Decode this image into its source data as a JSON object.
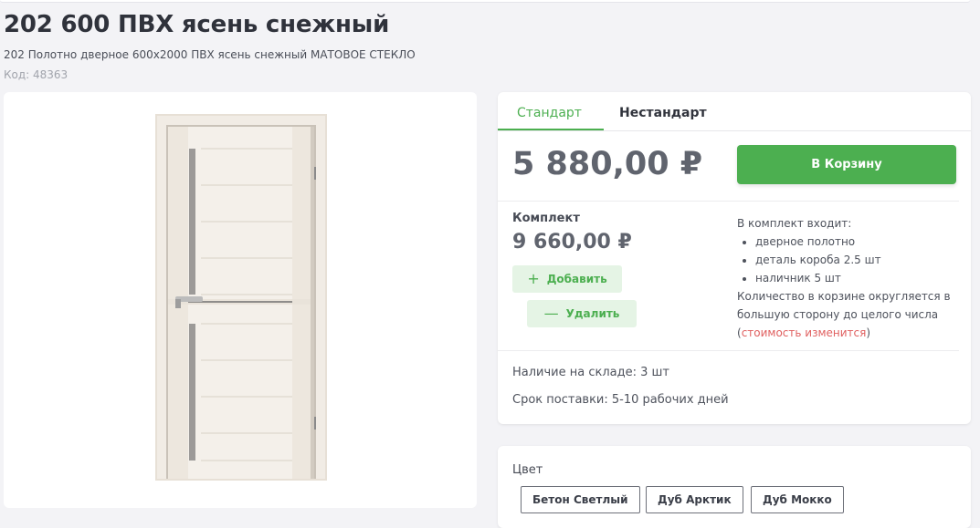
{
  "product": {
    "title": "202 600 ПВХ ясень снежный",
    "subtitle": "202 Полотно дверное 600х2000 ПВХ ясень снежный МАТОВОЕ СТЕКЛО",
    "code": "Код: 48363"
  },
  "tabs": [
    "Стандарт",
    "Нестандарт"
  ],
  "price": "5 880,00 ₽",
  "cart_button": "В Корзину",
  "kit": {
    "label": "Комплект",
    "price": "9 660,00 ₽",
    "add_label": "Добавить",
    "remove_label": "Удалить",
    "includes_title": "В комплект входит:",
    "items": [
      "дверное полотно",
      "деталь короба 2.5 шт",
      "наличник 5 шт"
    ],
    "note": "Количество в корзине округляется в большую сторону до целого числа",
    "note_paren_open": "(",
    "note_warning": "стоимость изменится",
    "note_paren_close": ")"
  },
  "stock": "Наличие на складе: 3 шт",
  "delivery": "Срок поставки: 5-10 рабочих дней",
  "colors": {
    "label": "Цвет",
    "options": [
      "Бетон Светлый",
      "Дуб Арктик",
      "Дуб Мокко"
    ]
  },
  "theme": {
    "accent": "#4caf50",
    "warning": "#e06060"
  }
}
